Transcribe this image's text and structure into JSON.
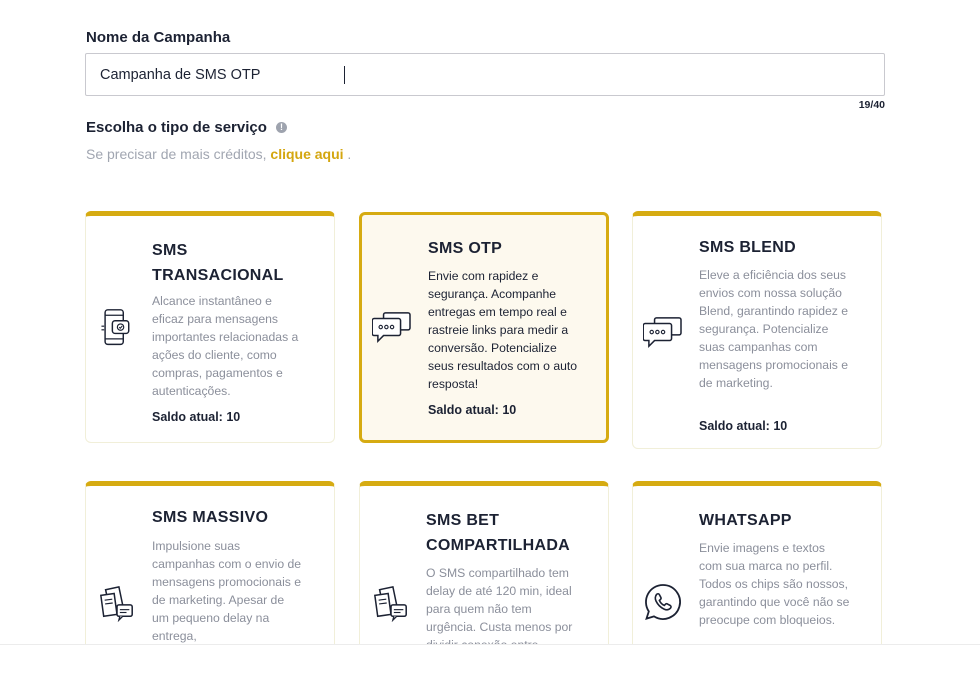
{
  "campaign": {
    "name_label": "Nome da Campanha",
    "name_value": "Campanha de SMS OTP",
    "counter": "19/40"
  },
  "service": {
    "label": "Escolha o tipo de serviço",
    "info_icon": "info-icon",
    "credits_prefix": "Se precisar de mais créditos, ",
    "credits_link": "clique aqui",
    "credits_suffix": " ."
  },
  "colors": {
    "accent": "#d6ab12",
    "link": "#d4a60f",
    "selected_bg": "#fdf9ee",
    "text_dark": "#1c2233",
    "text_muted": "#8b8f9b"
  },
  "cards": [
    {
      "title_line1": "SMS",
      "title_line2": "TRANSACIONAL",
      "description": "Alcance instantâneo e eficaz para mensagens importantes relacionadas a ações do cliente, como compras, pagamentos e autenticações.",
      "balance": "Saldo atual: 10",
      "icon": "mobile-message-icon",
      "selected": false
    },
    {
      "title_line1": "SMS OTP",
      "title_line2": "",
      "description": "Envie com rapidez e segurança. Acompanhe entregas em tempo real e rastreie links para medir a conversão. Potencialize seus resultados com o auto resposta!",
      "balance": "Saldo atual: 10",
      "icon": "chat-bubbles-icon",
      "selected": true
    },
    {
      "title_line1": "SMS BLEND",
      "title_line2": "",
      "description": "Eleve a eficiência dos seus envios com nossa solução Blend, garantindo rapidez e segurança. Potencialize suas campanhas com mensagens promocionais e de marketing.",
      "balance": "Saldo atual: 10",
      "icon": "chat-bubbles-icon",
      "selected": false
    },
    {
      "title_line1": "SMS MASSIVO",
      "title_line2": "",
      "description": "Impulsione suas campanhas com o envio de mensagens promocionais e de marketing. Apesar de um pequeno delay na entrega,",
      "balance": "",
      "icon": "documents-icon",
      "selected": false
    },
    {
      "title_line1": "SMS BET",
      "title_line2": "COMPARTILHADA",
      "description": "O SMS compartilhado tem delay de até 120 min, ideal para quem não tem urgência. Custa menos por dividir conexão entre",
      "balance": "",
      "icon": "documents-icon",
      "selected": false
    },
    {
      "title_line1": "WHATSAPP",
      "title_line2": "",
      "description": "Envie imagens e textos com sua marca no perfil. Todos os chips são nossos, garantindo que você não se preocupe com bloqueios.",
      "balance": "",
      "icon": "whatsapp-icon",
      "selected": false
    }
  ]
}
